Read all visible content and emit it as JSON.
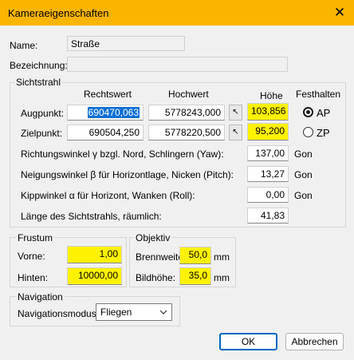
{
  "window": {
    "title": "Kameraeigenschaften",
    "close_glyph": "✕"
  },
  "name": {
    "label": "Name:",
    "value": "Straße"
  },
  "bezeichnung": {
    "label": "Bezeichnung:",
    "value": ""
  },
  "sichtstrahl": {
    "title": "Sichtstrahl",
    "col_rechtswert": "Rechtswert",
    "col_hochwert": "Hochwert",
    "col_hoehe": "Höhe",
    "col_festhalten": "Festhalten",
    "augpunkt": {
      "label": "Augpunkt:",
      "rechtswert": "690470,063",
      "hochwert": "5778243,000",
      "hoehe": "103,856"
    },
    "zielpunkt": {
      "label": "Zielpunkt:",
      "rechtswert": "690504,250",
      "hochwert": "5778220,500",
      "hoehe": "95,200"
    },
    "ap_label": "AP",
    "zp_label": "ZP",
    "festhalten_selected": "AP",
    "yaw": {
      "label": "Richtungswinkel γ bzgl. Nord, Schlingern (Yaw):",
      "value": "137,00",
      "unit": "Gon"
    },
    "pitch": {
      "label": "Neigungswinkel β für Horizontlage, Nicken (Pitch):",
      "value": "13,27",
      "unit": "Gon"
    },
    "roll": {
      "label": "Kippwinkel α für Horizont, Wanken (Roll):",
      "value": "0,00",
      "unit": "Gon"
    },
    "length": {
      "label": "Länge des Sichtstrahls, räumlich:",
      "value": "41,83"
    }
  },
  "frustum": {
    "title": "Frustum",
    "vorne": {
      "label": "Vorne:",
      "value": "1,00"
    },
    "hinten": {
      "label": "Hinten:",
      "value": "10000,00"
    }
  },
  "objektiv": {
    "title": "Objektiv",
    "brennweite": {
      "label": "Brennweite:",
      "value": "50,0",
      "unit": "mm"
    },
    "bildhoehe": {
      "label": "Bildhöhe:",
      "value": "35,0",
      "unit": "mm"
    }
  },
  "navigation": {
    "title": "Navigation",
    "modus_label": "Navigationsmodus:",
    "modus_value": "Fliegen"
  },
  "buttons": {
    "ok": "OK",
    "cancel": "Abbrechen"
  },
  "icons": {
    "pick": "cursor-pick-icon",
    "dropdown": "chevron-down-icon"
  },
  "colors": {
    "title_bar": "#fab501",
    "highlight": "#fef200",
    "selection": "#0a6fd6",
    "default_button_border": "#0067c0"
  }
}
